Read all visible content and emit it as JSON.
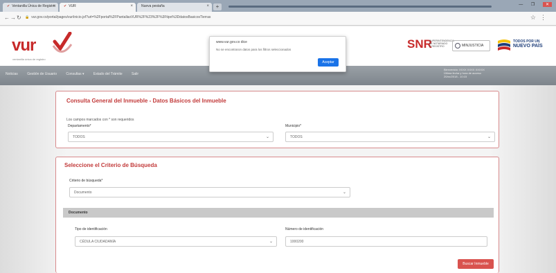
{
  "browser": {
    "tabs": [
      {
        "label": "Ventanilla Única de Registro"
      },
      {
        "label": "VUR"
      },
      {
        "label": "Nueva pestaña"
      }
    ],
    "new_tab": "+",
    "url": "vur.gov.co/portal/pages/vur/inicio.jsf?url=%2Fportal%2FPantallasVUR%2F%23%2F%3Ftipo%3DdatosBasicosTierras",
    "window_controls": "— ❐",
    "close": "✕"
  },
  "alert": {
    "site": "www.vur.gov.co dice",
    "message": "No se encontraron datos para los filtros seleccionados",
    "ok_label": "Aceptar"
  },
  "header": {
    "logo": "vur",
    "logo_sub": "ventanilla única de registro",
    "snr": "SNR",
    "snr_sub": [
      "SUPERINTENDENCIA",
      "DE NOTARIADO",
      "& REGISTRO"
    ],
    "minjusticia": "MINJUSTICIA",
    "todos": [
      "TODOS POR UN",
      "NUEVO PAÍS"
    ]
  },
  "nav": {
    "items": [
      "Noticias",
      "Gestión de Usuario",
      "Consultas ▾",
      "Estado del Trámite",
      "Salir"
    ],
    "user_lines": [
      "Bienvenido: XXXX XXXX XXXXX",
      "Última fecha y hora de acceso",
      "20/xx/2018 - 10:15"
    ]
  },
  "panel1": {
    "title": "Consulta General del Inmueble - Datos Básicos del Inmueble",
    "hint": "Los campos marcados con * son requeridos",
    "departamento_label": "Departamento*",
    "departamento_value": "TODOS",
    "municipio_label": "Municipio*",
    "municipio_value": "TODOS"
  },
  "panel2": {
    "title": "Seleccione el Criterio de Búsqueda",
    "criterio_label": "Criterio de búsqueda*",
    "criterio_value": "Documento",
    "section": "Documento",
    "tipo_label": "Tipo de identificación",
    "tipo_value": "CÉDULA CIUDADANÍA",
    "numero_label": "Número de identificación",
    "numero_value": "1000200",
    "button": "Buscar Inmueble"
  }
}
